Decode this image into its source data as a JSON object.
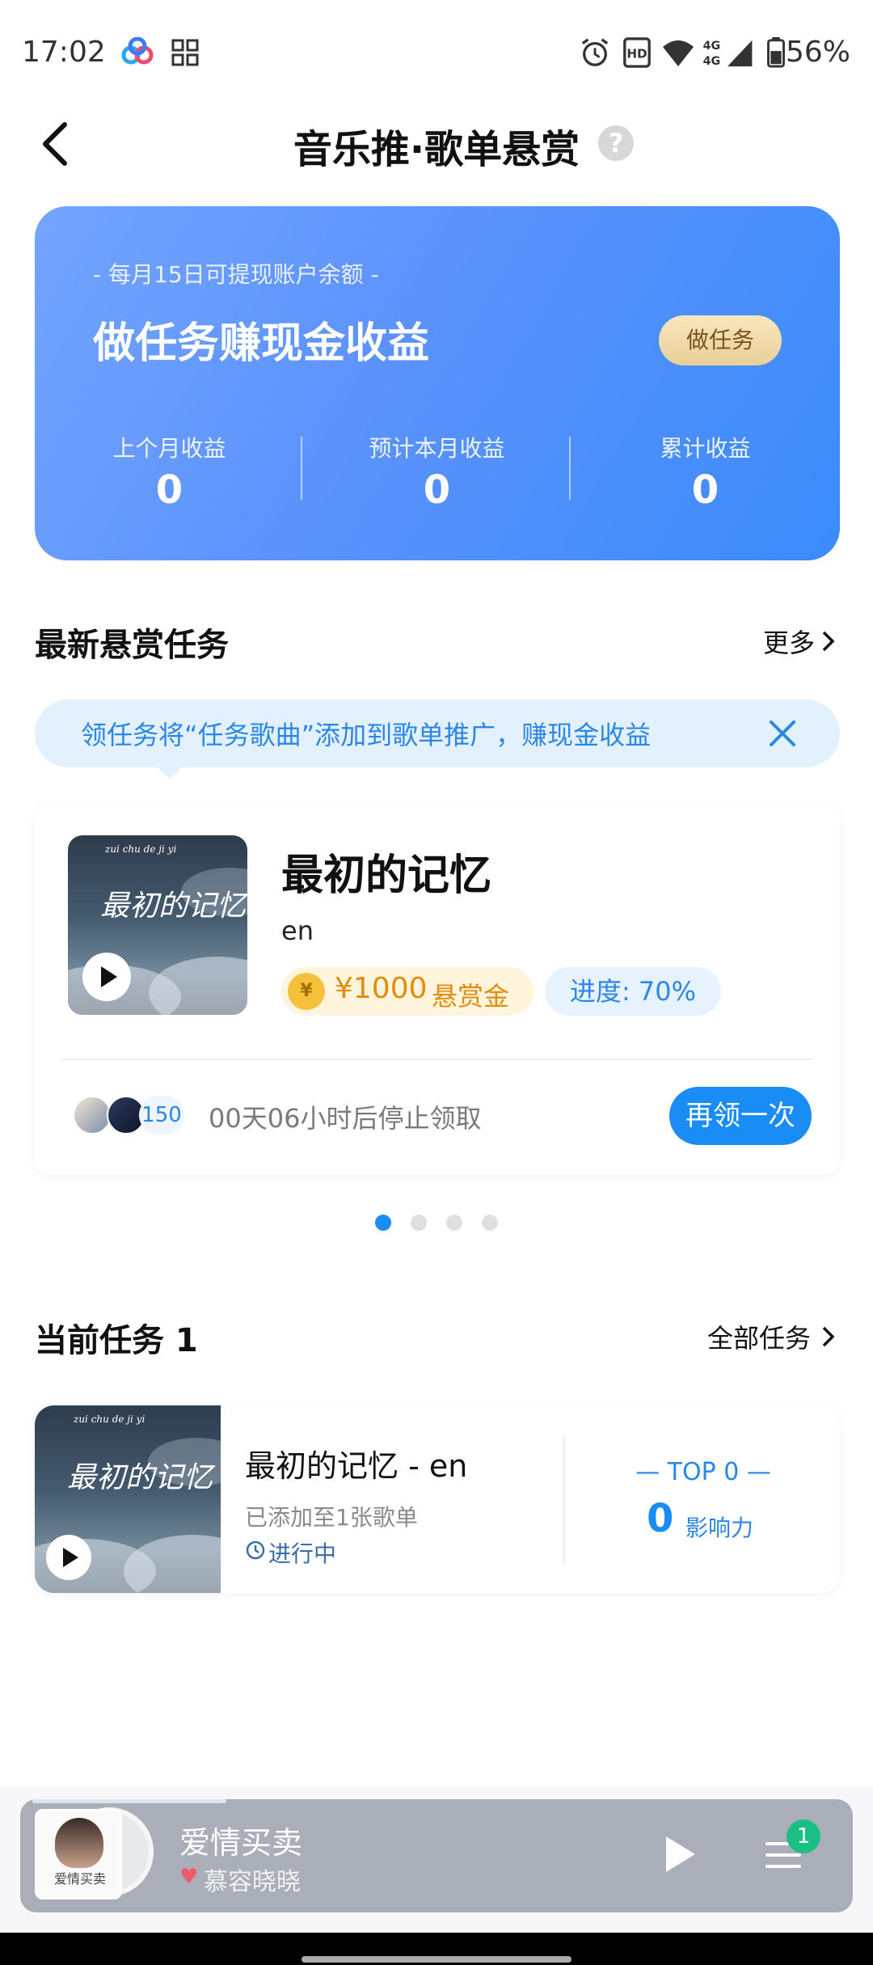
{
  "status_bar": {
    "time": "17:02",
    "battery": "56%",
    "network": "4G"
  },
  "header": {
    "title": "音乐推·歌单悬赏",
    "help_glyph": "?"
  },
  "earnings": {
    "subtitle": "- 每月15日可提现账户余额 -",
    "headline": "做任务赚现金收益",
    "cta": "做任务",
    "stats": [
      {
        "label": "上个月收益",
        "value": "0"
      },
      {
        "label": "预计本月收益",
        "value": "0"
      },
      {
        "label": "累计收益",
        "value": "0"
      }
    ]
  },
  "latest": {
    "title": "最新悬赏任务",
    "more": "更多",
    "tip": "领任务将“任务歌曲”添加到歌单推广，赚现金收益",
    "card": {
      "cover_text": "最初的记忆",
      "cover_pinyin": "zui chu de ji yi",
      "song": "最初的记忆",
      "artist": "en",
      "coin_glyph": "¥",
      "bounty_amount": "¥1000",
      "bounty_label": "悬赏金",
      "progress": "进度: 70%",
      "participants": "150",
      "countdown": "00天06小时后停止领取",
      "claim": "再领一次"
    },
    "dots": {
      "count": 4,
      "active": 0
    }
  },
  "current": {
    "title": "当前任务 1",
    "all": "全部任务",
    "card": {
      "cover_text": "最初的记忆",
      "cover_pinyin": "zui chu de ji yi",
      "title": "最初的记忆 - en",
      "added": "已添加至1张歌单",
      "status": "进行中",
      "rank": "— TOP 0 —",
      "score": "0",
      "score_label": "影响力"
    }
  },
  "player": {
    "song": "爱情买卖",
    "artist": "慕容晓晓",
    "queue_count": "1",
    "thumb_text": "爱情买卖"
  },
  "colors": {
    "accent": "#1a8cf5",
    "card_gradient_start": "#73a4ff",
    "card_gradient_end": "#3a8bfb",
    "gold": "#e38b0a"
  }
}
